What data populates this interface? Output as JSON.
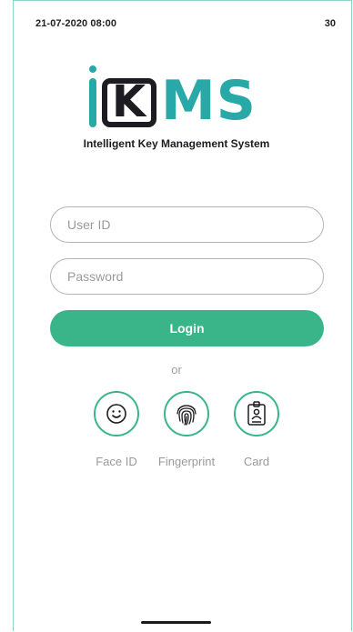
{
  "status_bar": {
    "datetime": "21-07-2020 08:00",
    "battery": "30"
  },
  "brand": {
    "logo_i": "i",
    "logo_k": "K",
    "logo_ms": "MS",
    "tagline": "Intelligent Key Management System",
    "colors": {
      "teal": "#28a8a6",
      "dark": "#1c1c22",
      "green_button": "#3ab58a"
    }
  },
  "login_form": {
    "user_id_placeholder": "User ID",
    "user_id_value": "",
    "password_placeholder": "Password",
    "password_value": "",
    "login_label": "Login",
    "or_label": "or"
  },
  "auth_options": [
    {
      "label": "Face ID",
      "icon": "face-smile-icon"
    },
    {
      "label": "Fingerprint",
      "icon": "fingerprint-icon"
    },
    {
      "label": "Card",
      "icon": "id-card-icon"
    }
  ]
}
